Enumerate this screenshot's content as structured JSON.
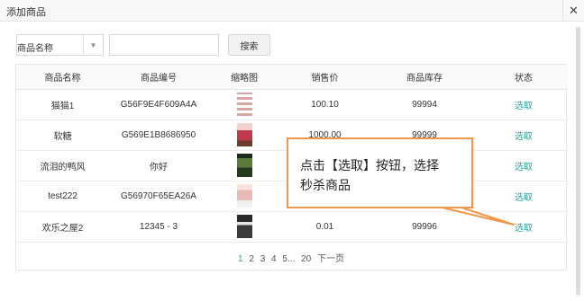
{
  "window": {
    "title": "添加商品",
    "close_glyph": "✕"
  },
  "search": {
    "field_select": "商品名称",
    "input_value": "",
    "button_label": "搜索"
  },
  "table": {
    "headers": [
      "商品名称",
      "商品编号",
      "缩略图",
      "销售价",
      "商品库存",
      "状态"
    ],
    "rows": [
      {
        "name": "猫猫1",
        "code": "G56F9E4F609A4A",
        "price": "100.10",
        "stock": "99994",
        "action": "选取"
      },
      {
        "name": "软糖",
        "code": "G569E1B8686950",
        "price": "1000.00",
        "stock": "99999",
        "action": "选取"
      },
      {
        "name": "流泪的鸭风",
        "code": "你好",
        "price": "",
        "stock": "",
        "action": "选取"
      },
      {
        "name": "test222",
        "code": "G56970F65EA26A",
        "price": "",
        "stock": "",
        "action": "选取"
      },
      {
        "name": "欢乐之屋2",
        "code": "12345 - 3",
        "price": "0.01",
        "stock": "99996",
        "action": "选取"
      }
    ]
  },
  "pager": {
    "pages": [
      "1",
      "2",
      "3",
      "4",
      "5...",
      "20"
    ],
    "next": "下一页"
  },
  "callout": {
    "line1": "点击【选取】按钮，选择",
    "line2": "秒杀商品"
  },
  "colors": {
    "accent": "#29a39a",
    "callout_border": "#f0974a"
  }
}
